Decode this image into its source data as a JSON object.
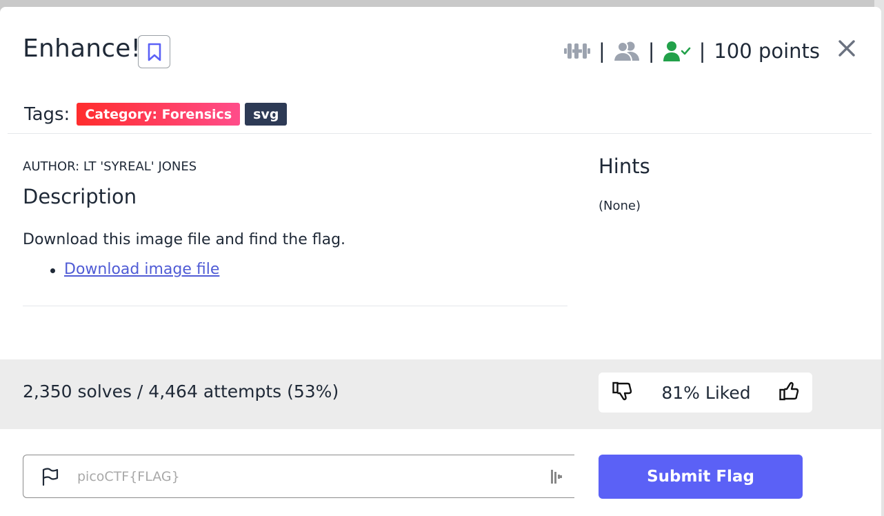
{
  "challenge": {
    "title": "Enhance!",
    "points_text": "100 points",
    "separator": "|",
    "tags_label": "Tags:",
    "tags": [
      "Category: Forensics",
      "svg"
    ]
  },
  "description": {
    "author": "AUTHOR: LT 'SYREAL' JONES",
    "heading": "Description",
    "text": "Download this image file and find the flag.",
    "link_label": "Download image file"
  },
  "hints": {
    "heading": "Hints",
    "value": "(None)"
  },
  "stats": {
    "summary": "2,350 solves / 4,464 attempts (53%)",
    "liked_text": "81% Liked"
  },
  "flag_form": {
    "placeholder": "picoCTF{FLAG}",
    "submit_label": "Submit Flag"
  },
  "colors": {
    "accent": "#5b61f6",
    "link": "#4f5bd5",
    "tag_forensics": "#ff3a5e",
    "tag_svg": "#2d3a55",
    "solved_icon": "#22a14a",
    "muted_icon": "#9ca3af"
  },
  "icons": [
    "bookmark-icon",
    "dumbbell-icon",
    "users-icon",
    "user-check-icon",
    "close-icon",
    "thumbs-down-icon",
    "thumbs-up-icon",
    "flag-icon",
    "password-manager-icon"
  ]
}
